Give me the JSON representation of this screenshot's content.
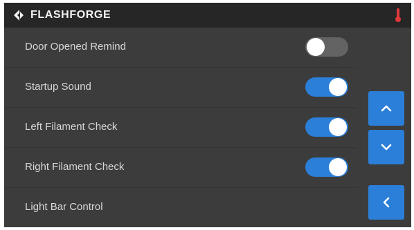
{
  "header": {
    "brand": "FLASHFORGE",
    "logo_icon": "flashforge-logo-icon",
    "status_icon": "thermometer-icon",
    "status_color": "#e0383b"
  },
  "settings": [
    {
      "label": "Door Opened Remind",
      "toggle": "off"
    },
    {
      "label": "Startup Sound",
      "toggle": "on"
    },
    {
      "label": "Left Filament Check",
      "toggle": "on"
    },
    {
      "label": "Right Filament Check",
      "toggle": "on"
    },
    {
      "label": "Light Bar Control"
    }
  ],
  "nav": {
    "up_icon": "chevron-up-icon",
    "down_icon": "chevron-down-icon",
    "back_icon": "chevron-left-icon"
  },
  "colors": {
    "accent": "#2b7fd8",
    "background": "#3c3c3c",
    "topbar": "#262626",
    "toggle_off": "#636363"
  }
}
